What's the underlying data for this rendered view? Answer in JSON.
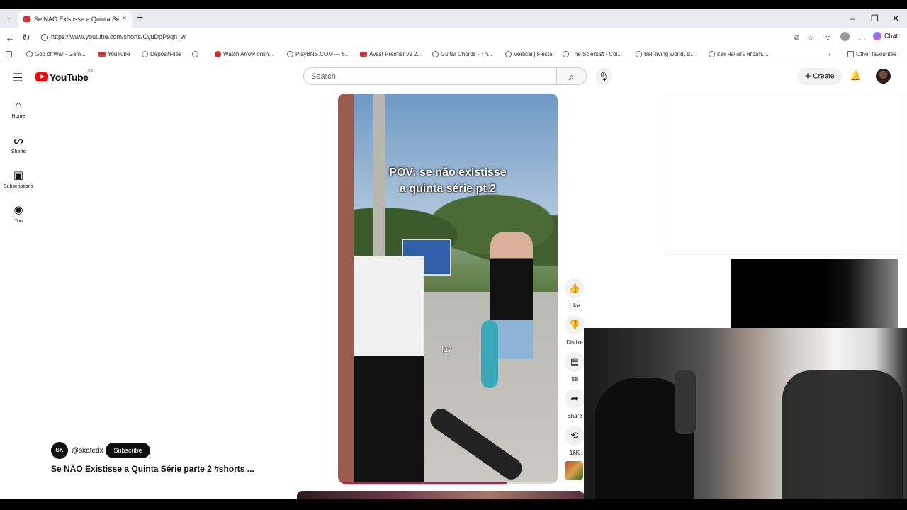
{
  "browser": {
    "tab_title": "Se NÃO Existisse a Quinta Série pa",
    "url": "https://www.youtube.com/shorts/CyuDpP9qn_w",
    "chat_label": "Chat",
    "bookmarks": [
      "God of War - Gam...",
      "YouTube",
      "DepositFiles",
      "",
      "Watch Arrow onlin...",
      "PlayBNS.COM — 6...",
      "Avast Premier v9 2...",
      "Guitar Chords - Th...",
      "Vertical | Fiesta",
      "The Scientist - Col...",
      "Bell-living world, B...",
      "Как начать играть..."
    ],
    "other_favourites": "Other favourites"
  },
  "youtube": {
    "logo_text": "YouTube",
    "country_code": "BR",
    "search_placeholder": "Search",
    "create_label": "Create",
    "nav": [
      {
        "label": "Home",
        "icon": "home-icon"
      },
      {
        "label": "Shorts",
        "icon": "shorts-icon"
      },
      {
        "label": "Subscriptions",
        "icon": "subscriptions-icon"
      },
      {
        "label": "You",
        "icon": "you-icon"
      }
    ]
  },
  "short": {
    "caption_line1": "POV: se não existisse",
    "caption_line2": "a quinta série pt.2",
    "subtitle": "lá?",
    "progress": 0.77,
    "channel_handle": "@skatedx",
    "subscribe_label": "Subscribe",
    "title": "Se NÃO Existisse a Quinta Série parte 2 #shorts ..."
  },
  "actions": {
    "like_label": "Like",
    "dislike_label": "Dislike",
    "comments_count": "58",
    "share_label": "Share",
    "remix_count": "16K"
  },
  "colors": {
    "youtube_red": "#ff0000",
    "progress_red": "#ff0033",
    "subscribe_bg": "#0f0f0f"
  }
}
